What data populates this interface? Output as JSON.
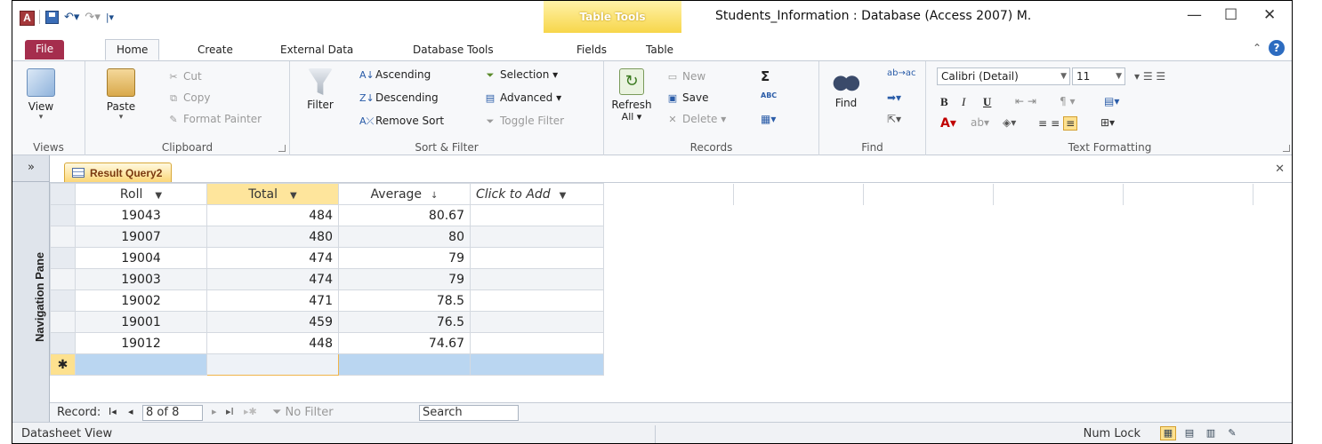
{
  "app": {
    "title": "Students_Information : Database (Access 2007) M.",
    "logo": "A",
    "context_tab_header": "Table Tools",
    "window_controls": {
      "minimize": "—",
      "maximize": "☐",
      "close": "✕"
    }
  },
  "tabs": [
    "File",
    "Home",
    "Create",
    "External Data",
    "Database Tools",
    "Fields",
    "Table"
  ],
  "ribbon": {
    "views": {
      "view": "View",
      "label": "Views"
    },
    "clipboard": {
      "paste": "Paste",
      "cut": "Cut",
      "copy": "Copy",
      "format_painter": "Format Painter",
      "label": "Clipboard"
    },
    "sort_filter": {
      "filter": "Filter",
      "ascending": "Ascending",
      "descending": "Descending",
      "remove_sort": "Remove Sort",
      "selection": "Selection ▾",
      "advanced": "Advanced ▾",
      "toggle_filter": "Toggle Filter",
      "label": "Sort & Filter"
    },
    "records": {
      "refresh": "Refresh",
      "refresh_sub": "All ▾",
      "new": "New",
      "save": "Save",
      "delete": "Delete ▾",
      "totals": "Σ",
      "spelling": "ABC",
      "label": "Records"
    },
    "find": {
      "find": "Find",
      "label": "Find"
    },
    "text_formatting": {
      "font": "Calibri (Detail)",
      "size": "11",
      "bold": "B",
      "italic": "I",
      "underline": "U",
      "label": "Text Formatting"
    }
  },
  "document": {
    "nav_pane_label": "Navigation Pane",
    "nav_toggle": "»",
    "tab_label": "Result Query2",
    "close": "✕",
    "columns": {
      "roll": "Roll",
      "total": "Total",
      "average": "Average",
      "add": "Click to Add"
    },
    "rows": [
      {
        "roll": "19043",
        "total": "484",
        "average": "80.67"
      },
      {
        "roll": "19007",
        "total": "480",
        "average": "80"
      },
      {
        "roll": "19004",
        "total": "474",
        "average": "79"
      },
      {
        "roll": "19003",
        "total": "474",
        "average": "79"
      },
      {
        "roll": "19002",
        "total": "471",
        "average": "78.5"
      },
      {
        "roll": "19001",
        "total": "459",
        "average": "76.5"
      },
      {
        "roll": "19012",
        "total": "448",
        "average": "74.67"
      }
    ],
    "new_row_marker": "✱"
  },
  "record_nav": {
    "label": "Record:",
    "first": "I◂",
    "prev": "◂",
    "position": "8 of 8",
    "next": "▸",
    "last": "▸I",
    "new": "▸✱",
    "filter": "No Filter",
    "search": "Search"
  },
  "statusbar": {
    "left": "Datasheet View",
    "numlock": "Num Lock"
  },
  "colors": {
    "file_tab": "#a52e4d",
    "selected_header": "#fee59c",
    "new_row": "#bad6f1",
    "context_tab": "#f7d64a"
  }
}
